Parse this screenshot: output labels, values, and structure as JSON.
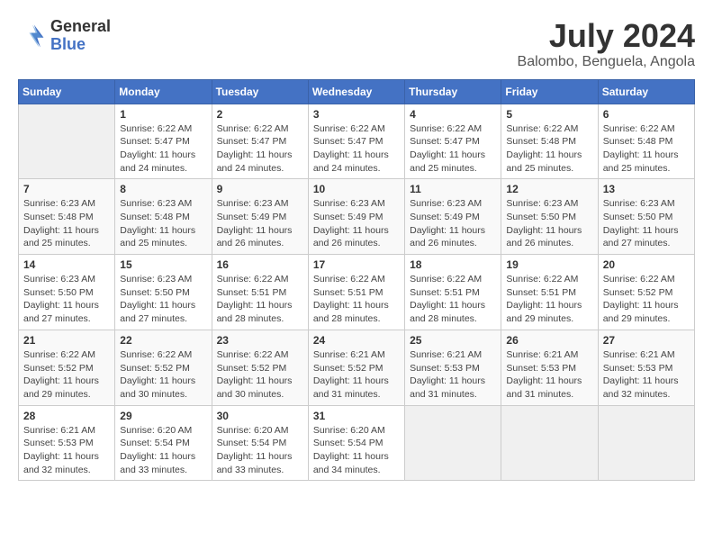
{
  "header": {
    "logo_line1": "General",
    "logo_line2": "Blue",
    "month": "July 2024",
    "location": "Balombo, Benguela, Angola"
  },
  "weekdays": [
    "Sunday",
    "Monday",
    "Tuesday",
    "Wednesday",
    "Thursday",
    "Friday",
    "Saturday"
  ],
  "weeks": [
    [
      {
        "day": "",
        "info": ""
      },
      {
        "day": "1",
        "info": "Sunrise: 6:22 AM\nSunset: 5:47 PM\nDaylight: 11 hours\nand 24 minutes."
      },
      {
        "day": "2",
        "info": "Sunrise: 6:22 AM\nSunset: 5:47 PM\nDaylight: 11 hours\nand 24 minutes."
      },
      {
        "day": "3",
        "info": "Sunrise: 6:22 AM\nSunset: 5:47 PM\nDaylight: 11 hours\nand 24 minutes."
      },
      {
        "day": "4",
        "info": "Sunrise: 6:22 AM\nSunset: 5:47 PM\nDaylight: 11 hours\nand 25 minutes."
      },
      {
        "day": "5",
        "info": "Sunrise: 6:22 AM\nSunset: 5:48 PM\nDaylight: 11 hours\nand 25 minutes."
      },
      {
        "day": "6",
        "info": "Sunrise: 6:22 AM\nSunset: 5:48 PM\nDaylight: 11 hours\nand 25 minutes."
      }
    ],
    [
      {
        "day": "7",
        "info": "Sunrise: 6:23 AM\nSunset: 5:48 PM\nDaylight: 11 hours\nand 25 minutes."
      },
      {
        "day": "8",
        "info": "Sunrise: 6:23 AM\nSunset: 5:48 PM\nDaylight: 11 hours\nand 25 minutes."
      },
      {
        "day": "9",
        "info": "Sunrise: 6:23 AM\nSunset: 5:49 PM\nDaylight: 11 hours\nand 26 minutes."
      },
      {
        "day": "10",
        "info": "Sunrise: 6:23 AM\nSunset: 5:49 PM\nDaylight: 11 hours\nand 26 minutes."
      },
      {
        "day": "11",
        "info": "Sunrise: 6:23 AM\nSunset: 5:49 PM\nDaylight: 11 hours\nand 26 minutes."
      },
      {
        "day": "12",
        "info": "Sunrise: 6:23 AM\nSunset: 5:50 PM\nDaylight: 11 hours\nand 26 minutes."
      },
      {
        "day": "13",
        "info": "Sunrise: 6:23 AM\nSunset: 5:50 PM\nDaylight: 11 hours\nand 27 minutes."
      }
    ],
    [
      {
        "day": "14",
        "info": "Sunrise: 6:23 AM\nSunset: 5:50 PM\nDaylight: 11 hours\nand 27 minutes."
      },
      {
        "day": "15",
        "info": "Sunrise: 6:23 AM\nSunset: 5:50 PM\nDaylight: 11 hours\nand 27 minutes."
      },
      {
        "day": "16",
        "info": "Sunrise: 6:22 AM\nSunset: 5:51 PM\nDaylight: 11 hours\nand 28 minutes."
      },
      {
        "day": "17",
        "info": "Sunrise: 6:22 AM\nSunset: 5:51 PM\nDaylight: 11 hours\nand 28 minutes."
      },
      {
        "day": "18",
        "info": "Sunrise: 6:22 AM\nSunset: 5:51 PM\nDaylight: 11 hours\nand 28 minutes."
      },
      {
        "day": "19",
        "info": "Sunrise: 6:22 AM\nSunset: 5:51 PM\nDaylight: 11 hours\nand 29 minutes."
      },
      {
        "day": "20",
        "info": "Sunrise: 6:22 AM\nSunset: 5:52 PM\nDaylight: 11 hours\nand 29 minutes."
      }
    ],
    [
      {
        "day": "21",
        "info": "Sunrise: 6:22 AM\nSunset: 5:52 PM\nDaylight: 11 hours\nand 29 minutes."
      },
      {
        "day": "22",
        "info": "Sunrise: 6:22 AM\nSunset: 5:52 PM\nDaylight: 11 hours\nand 30 minutes."
      },
      {
        "day": "23",
        "info": "Sunrise: 6:22 AM\nSunset: 5:52 PM\nDaylight: 11 hours\nand 30 minutes."
      },
      {
        "day": "24",
        "info": "Sunrise: 6:21 AM\nSunset: 5:52 PM\nDaylight: 11 hours\nand 31 minutes."
      },
      {
        "day": "25",
        "info": "Sunrise: 6:21 AM\nSunset: 5:53 PM\nDaylight: 11 hours\nand 31 minutes."
      },
      {
        "day": "26",
        "info": "Sunrise: 6:21 AM\nSunset: 5:53 PM\nDaylight: 11 hours\nand 31 minutes."
      },
      {
        "day": "27",
        "info": "Sunrise: 6:21 AM\nSunset: 5:53 PM\nDaylight: 11 hours\nand 32 minutes."
      }
    ],
    [
      {
        "day": "28",
        "info": "Sunrise: 6:21 AM\nSunset: 5:53 PM\nDaylight: 11 hours\nand 32 minutes."
      },
      {
        "day": "29",
        "info": "Sunrise: 6:20 AM\nSunset: 5:54 PM\nDaylight: 11 hours\nand 33 minutes."
      },
      {
        "day": "30",
        "info": "Sunrise: 6:20 AM\nSunset: 5:54 PM\nDaylight: 11 hours\nand 33 minutes."
      },
      {
        "day": "31",
        "info": "Sunrise: 6:20 AM\nSunset: 5:54 PM\nDaylight: 11 hours\nand 34 minutes."
      },
      {
        "day": "",
        "info": ""
      },
      {
        "day": "",
        "info": ""
      },
      {
        "day": "",
        "info": ""
      }
    ]
  ]
}
